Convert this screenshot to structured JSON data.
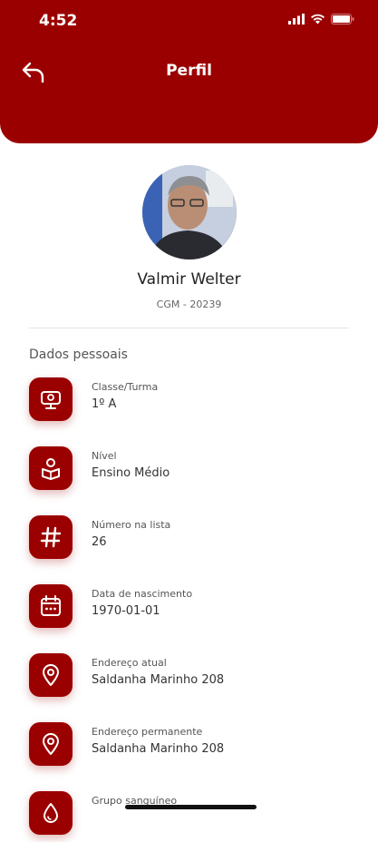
{
  "status_bar": {
    "time": "4:52"
  },
  "header": {
    "title": "Perfil"
  },
  "profile": {
    "name": "Valmir Welter",
    "code": "CGM - 20239"
  },
  "section": {
    "title": "Dados pessoais"
  },
  "fields": [
    {
      "label": "Classe/Turma",
      "value": "1º A",
      "icon": "chalkboard-icon"
    },
    {
      "label": "Nível",
      "value": "Ensino Médio",
      "icon": "student-reading-icon"
    },
    {
      "label": "Número na lista",
      "value": "26",
      "icon": "hash-icon"
    },
    {
      "label": "Data de nascimento",
      "value": "1970-01-01",
      "icon": "calendar-icon"
    },
    {
      "label": "Endereço atual",
      "value": "Saldanha Marinho 208",
      "icon": "location-pin-icon"
    },
    {
      "label": "Endereço permanente",
      "value": "Saldanha Marinho 208",
      "icon": "location-pin-icon"
    },
    {
      "label": "Grupo sanguíneo",
      "value": "",
      "icon": "blood-drop-icon"
    }
  ],
  "colors": {
    "primary": "#9b0000",
    "background": "#ffffff"
  }
}
